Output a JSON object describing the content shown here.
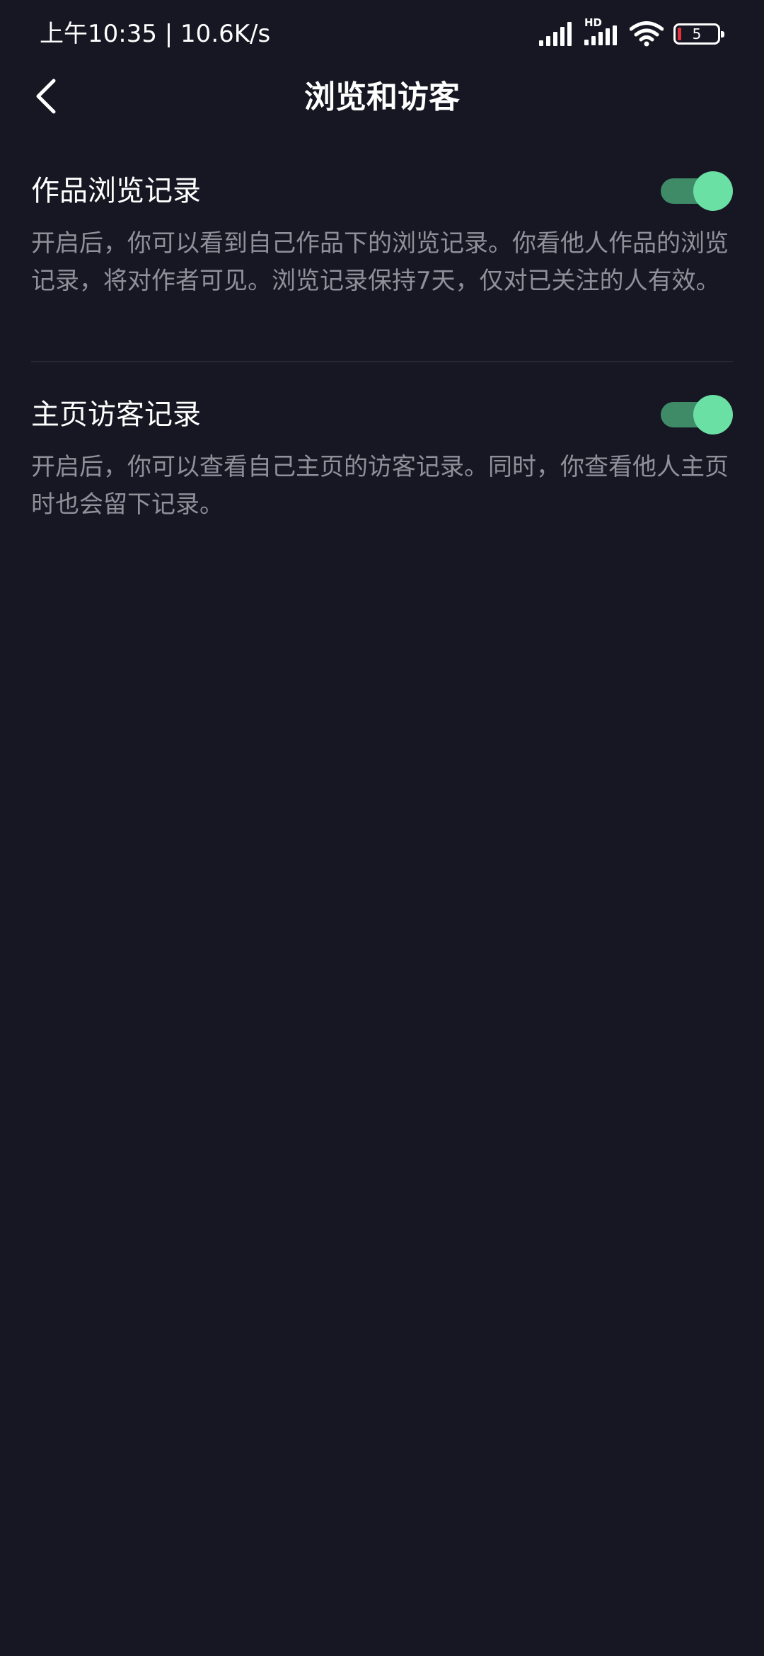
{
  "status_bar": {
    "time_speed": "上午10:35 | 10.6K/s",
    "hd_label": "HD",
    "battery_level": "5"
  },
  "header": {
    "title": "浏览和访客"
  },
  "settings": [
    {
      "title": "作品浏览记录",
      "description": "开启后，你可以看到自己作品下的浏览记录。你看他人作品的浏览记录，将对作者可见。浏览记录保持7天，仅对已关注的人有效。",
      "enabled": true
    },
    {
      "title": "主页访客记录",
      "description": "开启后，你可以查看自己主页的访客记录。同时，你查看他人主页时也会留下记录。",
      "enabled": true
    }
  ],
  "colors": {
    "background": "#161722",
    "toggle_track": "#3f8a67",
    "toggle_knob": "#6be0a5",
    "description_text": "#8f909a"
  }
}
